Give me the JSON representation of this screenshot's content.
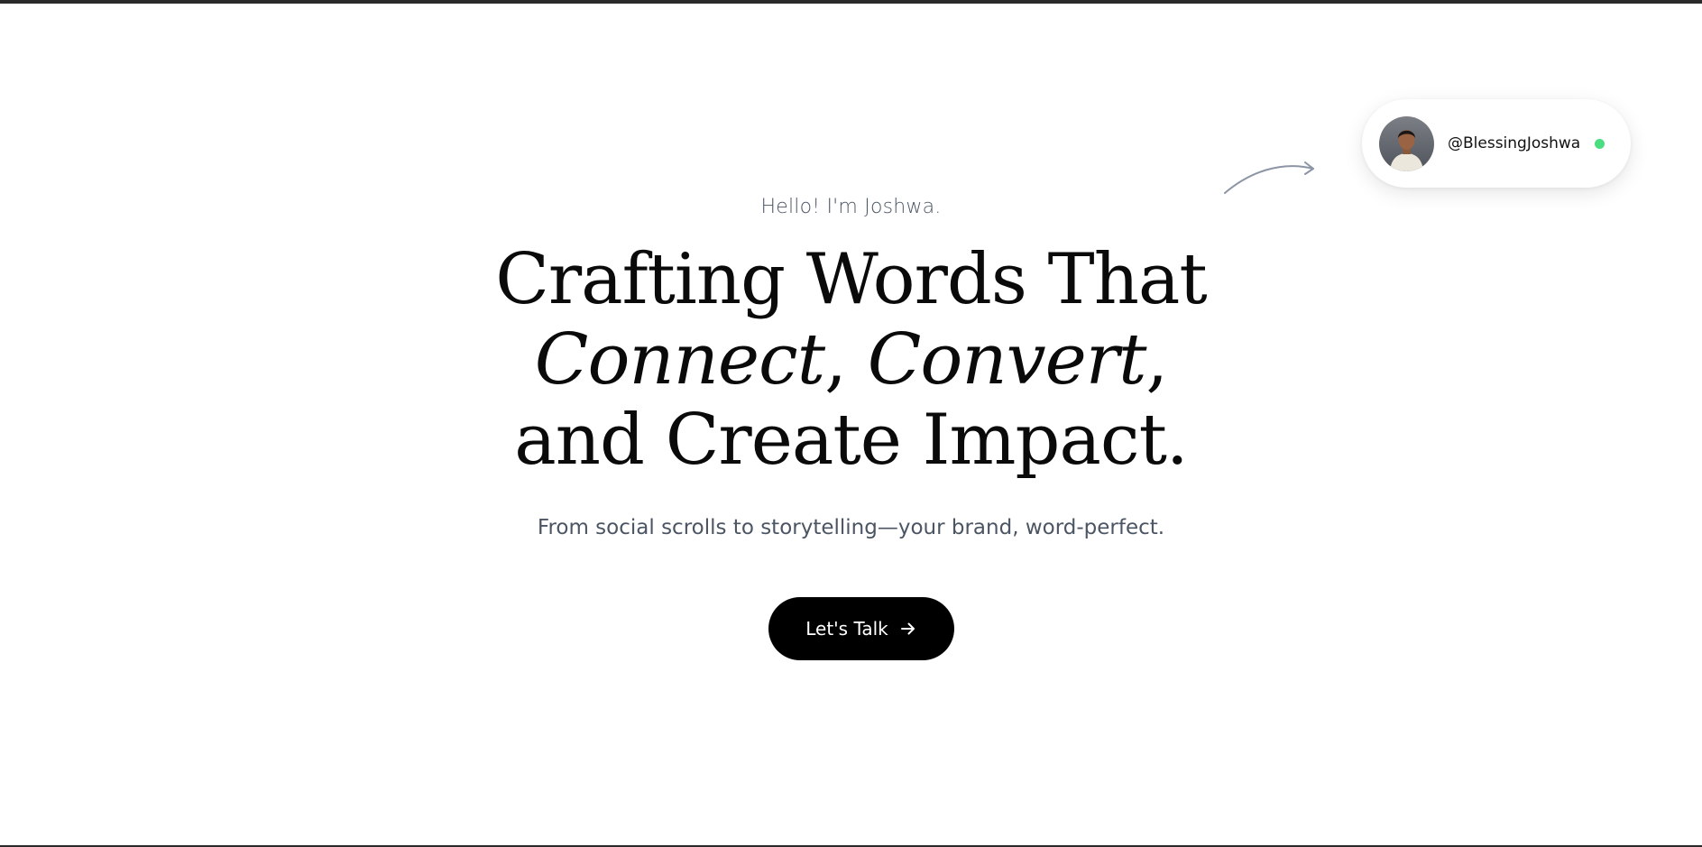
{
  "hero": {
    "greeting": "Hello! I'm Joshwa.",
    "headline": {
      "line1": "Crafting Words That",
      "line2_italic_1": "Connect",
      "line2_sep": ", ",
      "line2_italic_2": "Convert",
      "line2_end": ",",
      "line3": "and Create Impact."
    },
    "subtitle": "From social scrolls to storytelling—your brand, word-perfect.",
    "cta_label": "Let's Talk"
  },
  "profile": {
    "handle": "@BlessingJoshwa",
    "status": "online",
    "status_color": "#4ade80"
  },
  "icons": {
    "cta": "arrow-right-icon",
    "decoration": "curved-arrow-icon"
  },
  "colors": {
    "background": "#ffffff",
    "text": "#0a0a0a",
    "muted": "#4b5563",
    "button": "#000000"
  }
}
